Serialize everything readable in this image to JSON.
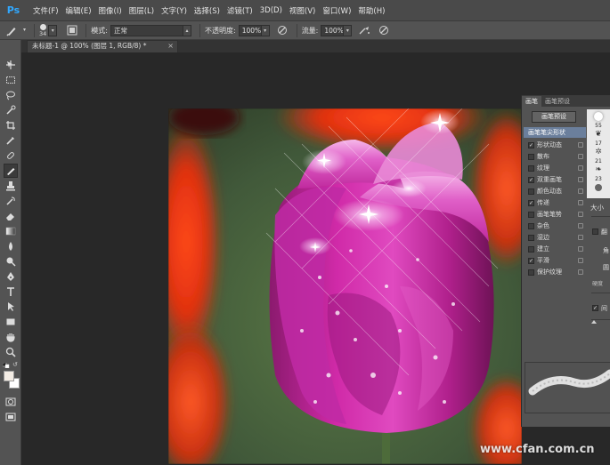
{
  "app": {
    "logo": "Ps"
  },
  "menu": [
    "文件(F)",
    "编辑(E)",
    "图像(I)",
    "图层(L)",
    "文字(Y)",
    "选择(S)",
    "滤镜(T)",
    "3D(D)",
    "视图(V)",
    "窗口(W)",
    "帮助(H)"
  ],
  "options": {
    "brush_size": "34",
    "mode_label": "模式:",
    "mode_value": "正常",
    "opacity_label": "不透明度:",
    "opacity_value": "100%",
    "flow_label": "流量:",
    "flow_value": "100%"
  },
  "document": {
    "tab_title": "未标题-1 @ 100% (图层 1, RGB/8) *",
    "close_symbol": "×"
  },
  "brush_panel": {
    "tabs": [
      "画笔",
      "画笔预设"
    ],
    "preset_button": "画笔预设",
    "tip_shape": "画笔笔尖形状",
    "options": [
      {
        "label": "形状动态",
        "checked": true
      },
      {
        "label": "散布",
        "checked": false
      },
      {
        "label": "纹理",
        "checked": false
      },
      {
        "label": "双重画笔",
        "checked": true
      },
      {
        "label": "颜色动态",
        "checked": false
      },
      {
        "label": "传递",
        "checked": true
      },
      {
        "label": "画笔笔势",
        "checked": false
      },
      {
        "label": "杂色",
        "checked": false
      },
      {
        "label": "湿边",
        "checked": false
      },
      {
        "label": "建立",
        "checked": false
      },
      {
        "label": "平滑",
        "checked": true
      },
      {
        "label": "保护纹理",
        "checked": false
      }
    ],
    "brush_sizes": [
      "55",
      "17",
      "21",
      "23"
    ],
    "size_label": "大小",
    "flip_label": "翻",
    "angle_label": "角",
    "round_label": "圆",
    "hardness_label": "硬度",
    "spacing_label": "间",
    "spacing_checked": true
  },
  "watermark": "www.cfan.com.cn",
  "colors": {
    "menubar": "#4a4a4a",
    "panel": "#535353",
    "canvas_bg": "#282828",
    "accent": "#31a8ff",
    "selected_row": "#6b7f9c"
  }
}
